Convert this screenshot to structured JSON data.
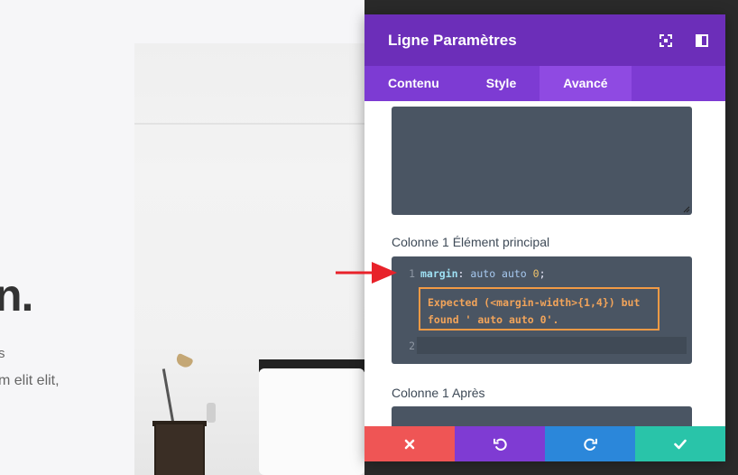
{
  "page": {
    "hero_title": "n.",
    "hero_line1": "s",
    "hero_line2": "m elit elit,"
  },
  "panel": {
    "title": "Ligne Paramètres",
    "icons": {
      "fullscreen": "fullscreen-icon",
      "sidebar": "sidebar-icon"
    },
    "tabs": [
      {
        "label": "Contenu",
        "active": false
      },
      {
        "label": "Style",
        "active": false
      },
      {
        "label": "Avancé",
        "active": true
      }
    ],
    "fields": {
      "main_label": "Colonne 1 Élément principal",
      "after_label": "Colonne 1 Après"
    },
    "code": {
      "line1_num": "1",
      "line2_num": "2",
      "property": "margin",
      "colon": ":",
      "value": "auto auto",
      "number": "0",
      "semicolon": ";",
      "error_line1": "Expected (<margin-width>{1,4}) but",
      "error_line2": "found ' auto auto 0'."
    },
    "footer": {
      "cancel": "close-icon",
      "undo": "undo-icon",
      "redo": "redo-icon",
      "save": "check-icon"
    }
  },
  "colors": {
    "header": "#6c2eb9",
    "tabs": "#7d3bd3",
    "tab_active": "#8f4ae2",
    "cancel": "#ef5555",
    "undo": "#7f3bd3",
    "redo": "#2b87da",
    "save": "#29c4a9",
    "error": "#f29a45",
    "arrow": "#e8222a"
  }
}
